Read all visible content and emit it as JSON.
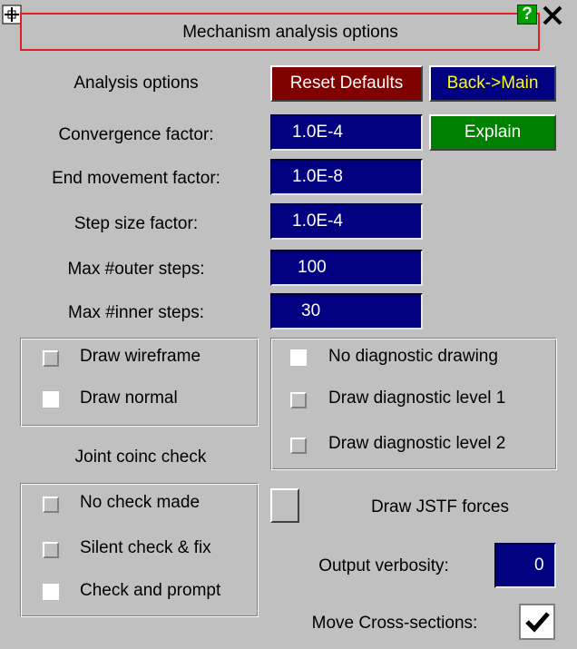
{
  "window": {
    "title": "Mechanism analysis options",
    "help_label": "?",
    "close_label": "✕"
  },
  "header": {
    "analysis_options_label": "Analysis options",
    "reset_defaults_label": "Reset Defaults",
    "back_main_label": "Back->Main",
    "explain_label": "Explain"
  },
  "fields": [
    {
      "label": "Convergence factor:",
      "value": "1.0E-4"
    },
    {
      "label": "End movement factor:",
      "value": "1.0E-8"
    },
    {
      "label": "Step size factor:",
      "value": "1.0E-4"
    },
    {
      "label": "Max #outer steps:",
      "value": "100"
    },
    {
      "label": "Max #inner steps:",
      "value": "30"
    }
  ],
  "draw_mode": {
    "options": [
      {
        "label": "Draw wireframe",
        "selected": false
      },
      {
        "label": "Draw normal",
        "selected": true
      }
    ]
  },
  "diagnostic": {
    "options": [
      {
        "label": "No diagnostic drawing",
        "selected": true
      },
      {
        "label": "Draw diagnostic level 1",
        "selected": false
      },
      {
        "label": "Draw diagnostic level 2",
        "selected": false
      }
    ]
  },
  "joint_check": {
    "heading": "Joint coinc check",
    "options": [
      {
        "label": "No check made",
        "selected": false
      },
      {
        "label": "Silent check & fix",
        "selected": false
      },
      {
        "label": "Check and prompt",
        "selected": true
      }
    ]
  },
  "jstf": {
    "label": "Draw JSTF forces"
  },
  "verbosity": {
    "label": "Output verbosity:",
    "value": "0"
  },
  "cross_sections": {
    "label": "Move Cross-sections:",
    "checked": true
  },
  "colors": {
    "background": "#c0c0c0",
    "field_blue": "#000080",
    "reset_red": "#800000",
    "explain_green": "#008000",
    "title_border_red": "#e02020",
    "back_text_yellow": "#ffff00"
  }
}
